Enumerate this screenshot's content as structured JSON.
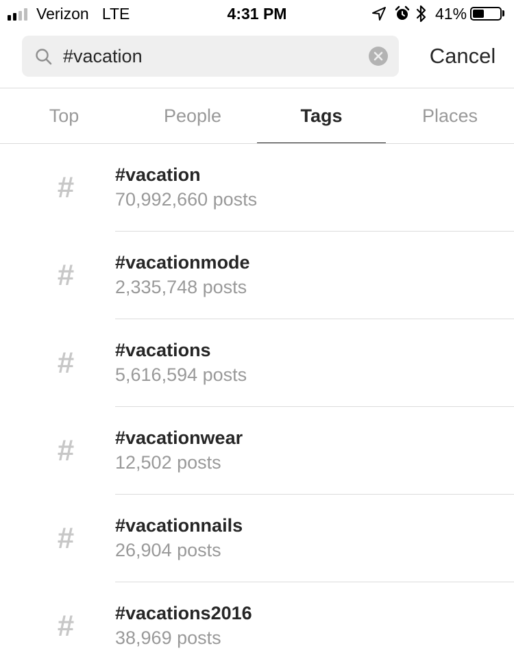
{
  "status_bar": {
    "carrier": "Verizon",
    "network": "LTE",
    "time": "4:31 PM",
    "battery_percent": "41%",
    "battery_level": 0.41,
    "signal_bars_filled": 2,
    "signal_bars_total": 4,
    "icons": [
      "location-arrow-icon",
      "alarm-icon",
      "bluetooth-icon",
      "battery-icon"
    ]
  },
  "search": {
    "value": "#vacation",
    "clear_icon": "clear-icon",
    "search_icon": "search-icon",
    "cancel_label": "Cancel"
  },
  "tabs": [
    {
      "label": "Top",
      "active": false
    },
    {
      "label": "People",
      "active": false
    },
    {
      "label": "Tags",
      "active": true
    },
    {
      "label": "Places",
      "active": false
    }
  ],
  "results": [
    {
      "icon": "#",
      "name": "#vacation",
      "count": "70,992,660 posts"
    },
    {
      "icon": "#",
      "name": "#vacationmode",
      "count": "2,335,748 posts"
    },
    {
      "icon": "#",
      "name": "#vacations",
      "count": "5,616,594 posts"
    },
    {
      "icon": "#",
      "name": "#vacationwear",
      "count": "12,502 posts"
    },
    {
      "icon": "#",
      "name": "#vacationnails",
      "count": "26,904 posts"
    },
    {
      "icon": "#",
      "name": "#vacations2016",
      "count": "38,969 posts"
    }
  ],
  "colors": {
    "text_primary": "#262626",
    "text_secondary": "#999999",
    "hash_icon": "#c7c7c7",
    "search_bg": "#efefef",
    "divider": "#dbdbdb"
  }
}
